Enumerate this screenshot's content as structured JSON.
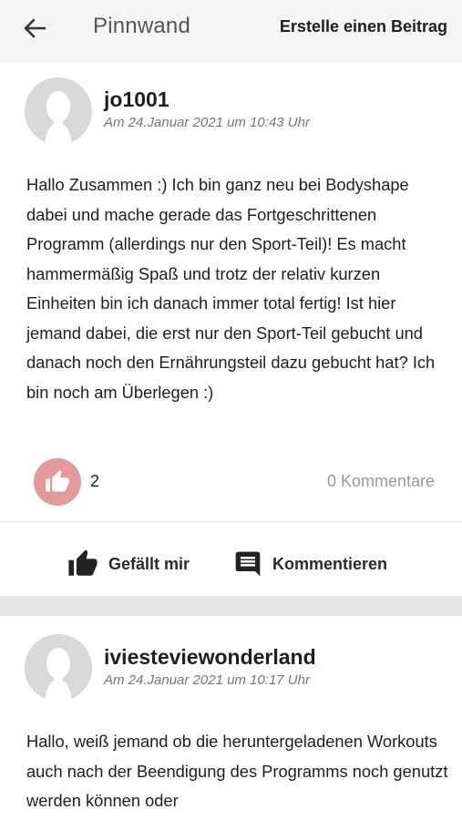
{
  "header": {
    "title": "Pinnwand",
    "create_post_label": "Erstelle einen Beitrag"
  },
  "posts": [
    {
      "username": "jo1001",
      "timestamp": "Am 24.Januar 2021 um 10:43 Uhr",
      "text": "Hallo Zusammen :) Ich bin ganz neu bei Bodyshape dabei und mache gerade das Fortgeschrittenen Programm (allerdings nur den Sport-Teil)! Es macht hammermäßig Spaß und trotz der relativ kurzen Einheiten bin ich danach immer total fertig! Ist hier jemand dabei, die erst nur den Sport-Teil gebucht und danach noch den Ernährungsteil dazu gebucht hat? Ich bin noch am Überlegen :)",
      "like_count": "2",
      "comment_count": "0 Kommentare",
      "like_action_label": "Gefällt mir",
      "comment_action_label": "Kommentieren"
    },
    {
      "username": "iviesteviewonderland",
      "timestamp": "Am 24.Januar 2021 um 10:17 Uhr",
      "text": "Hallo, weiß jemand ob die heruntergeladenen Workouts auch nach der Beendigung des Programms noch genutzt werden können oder"
    }
  ],
  "icons": {
    "back": "arrow-left-icon",
    "like": "thumbs-up-icon",
    "comment": "comment-icon",
    "avatar": "user-silhouette-icon"
  },
  "colors": {
    "header_bg": "#f5f5f5",
    "like_badge": "#e59a9a",
    "separator": "#e6e6e6",
    "muted_text": "#9a9a9a"
  }
}
